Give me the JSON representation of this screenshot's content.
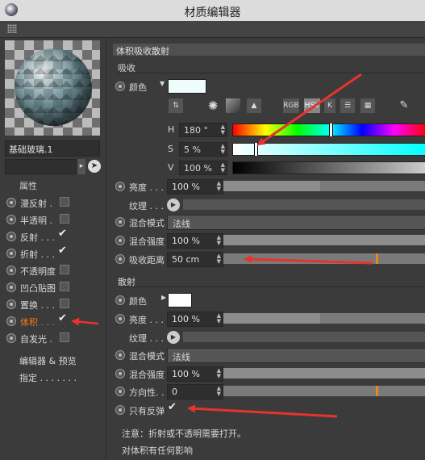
{
  "window": {
    "title": "材质编辑器"
  },
  "material": {
    "name": "基础玻璃.1"
  },
  "sidebar": {
    "attributes_title": "属性",
    "channels": [
      {
        "label": "漫反射 .",
        "checked": false
      },
      {
        "label": "半透明 .",
        "checked": false
      },
      {
        "label": "反射 . . .",
        "checked": true
      },
      {
        "label": "折射 . . .",
        "checked": true
      },
      {
        "label": "不透明度",
        "checked": false
      },
      {
        "label": "凹凸贴图",
        "checked": false
      },
      {
        "label": "置换 . . .",
        "checked": false
      },
      {
        "label": "体积 . . .",
        "checked": true,
        "active": true
      },
      {
        "label": "自发光 .",
        "checked": false
      }
    ],
    "editor_preview": "编辑器 & 预览",
    "assign": "指定 . . . . . . ."
  },
  "panel": {
    "title": "体积吸收散射",
    "absorption": {
      "section": "吸收",
      "color_label": "颜色",
      "color_value": "#eefcfc",
      "color_mode_buttons": [
        "RGB",
        "HSV",
        "K"
      ],
      "h_label": "H",
      "h_value": "180 °",
      "h_level": 0.5,
      "s_label": "S",
      "s_value": "5 %",
      "s_level": 0.05,
      "v_label": "V",
      "v_value": "100 %",
      "v_level": 1.0,
      "brightness_label": "亮度 . . .",
      "brightness_value": "100 %",
      "texture_label": "纹理 . . .",
      "blend_mode_label": "混合模式",
      "blend_mode_value": "法线",
      "blend_strength_label": "混合强度",
      "blend_strength_value": "100 %",
      "distance_label": "吸收距离",
      "distance_value": "50 cm"
    },
    "scatter": {
      "section": "散射",
      "color_label": "颜色",
      "color_value": "#ffffff",
      "brightness_label": "亮度 . . .",
      "brightness_value": "100 %",
      "texture_label": "纹理 . . .",
      "blend_mode_label": "混合模式",
      "blend_mode_value": "法线",
      "blend_strength_label": "混合强度",
      "blend_strength_value": "100 %",
      "direction_label": "方向性. .",
      "direction_value": "0",
      "reflect_only_label": "只有反弹",
      "reflect_only_checked": true
    },
    "note1": "注意：折射或不透明需要打开。",
    "note2": "对体积有任何影响"
  },
  "colors": {
    "accent": "#f07a1a",
    "annotation": "#e8332b"
  }
}
